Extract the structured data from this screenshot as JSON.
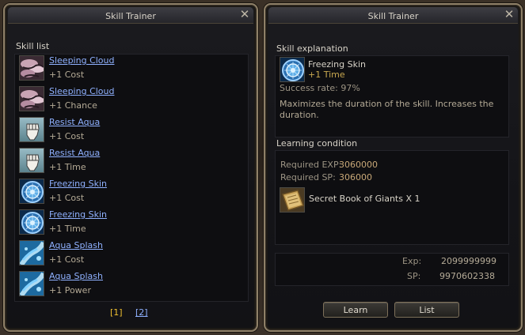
{
  "left_window": {
    "title": "Skill Trainer",
    "close_glyph": "✕",
    "list_label": "Skill list",
    "skills": [
      {
        "name": "Sleeping Cloud",
        "detail": "+1 Cost",
        "icon": "sleeping-cloud-icon"
      },
      {
        "name": "Sleeping Cloud",
        "detail": "+1 Chance",
        "icon": "sleeping-cloud-icon"
      },
      {
        "name": "Resist Aqua",
        "detail": "+1 Cost",
        "icon": "fist-icon"
      },
      {
        "name": "Resist Aqua",
        "detail": "+1 Time",
        "icon": "fist-icon"
      },
      {
        "name": "Freezing Skin",
        "detail": "+1 Cost",
        "icon": "freezing-skin-icon"
      },
      {
        "name": "Freezing Skin",
        "detail": "+1 Time",
        "icon": "freezing-skin-icon"
      },
      {
        "name": "Aqua Splash",
        "detail": "+1 Cost",
        "icon": "aqua-splash-icon"
      },
      {
        "name": "Aqua Splash",
        "detail": "+1 Power",
        "icon": "aqua-splash-icon"
      }
    ],
    "pages": [
      "[1]",
      "[2]"
    ],
    "current_page": "[1]"
  },
  "right_window": {
    "title": "Skill Trainer",
    "close_glyph": "✕",
    "explanation_label": "Skill explanation",
    "skill_name": "Freezing Skin",
    "skill_enchant": "+1 Time",
    "success_rate": "Success rate: 97%",
    "description": "Maximizes the duration of the skill. Increases the duration.",
    "learning_label": "Learning condition",
    "required_exp_label": "Required EXP:",
    "required_exp": "3060000",
    "required_sp_label": "Required SP:",
    "required_sp": "306000",
    "item_name": "Secret Book of Giants X 1",
    "exp_label": "Exp:",
    "exp_value": "2099999999",
    "sp_label": "SP:",
    "sp_value": "9970602338",
    "learn_button": "Learn",
    "list_button": "List"
  },
  "colors": {
    "link": "#8fb1ff",
    "value": "#c8a878",
    "current_page": "#f0c030",
    "enchant": "#c8a850"
  }
}
